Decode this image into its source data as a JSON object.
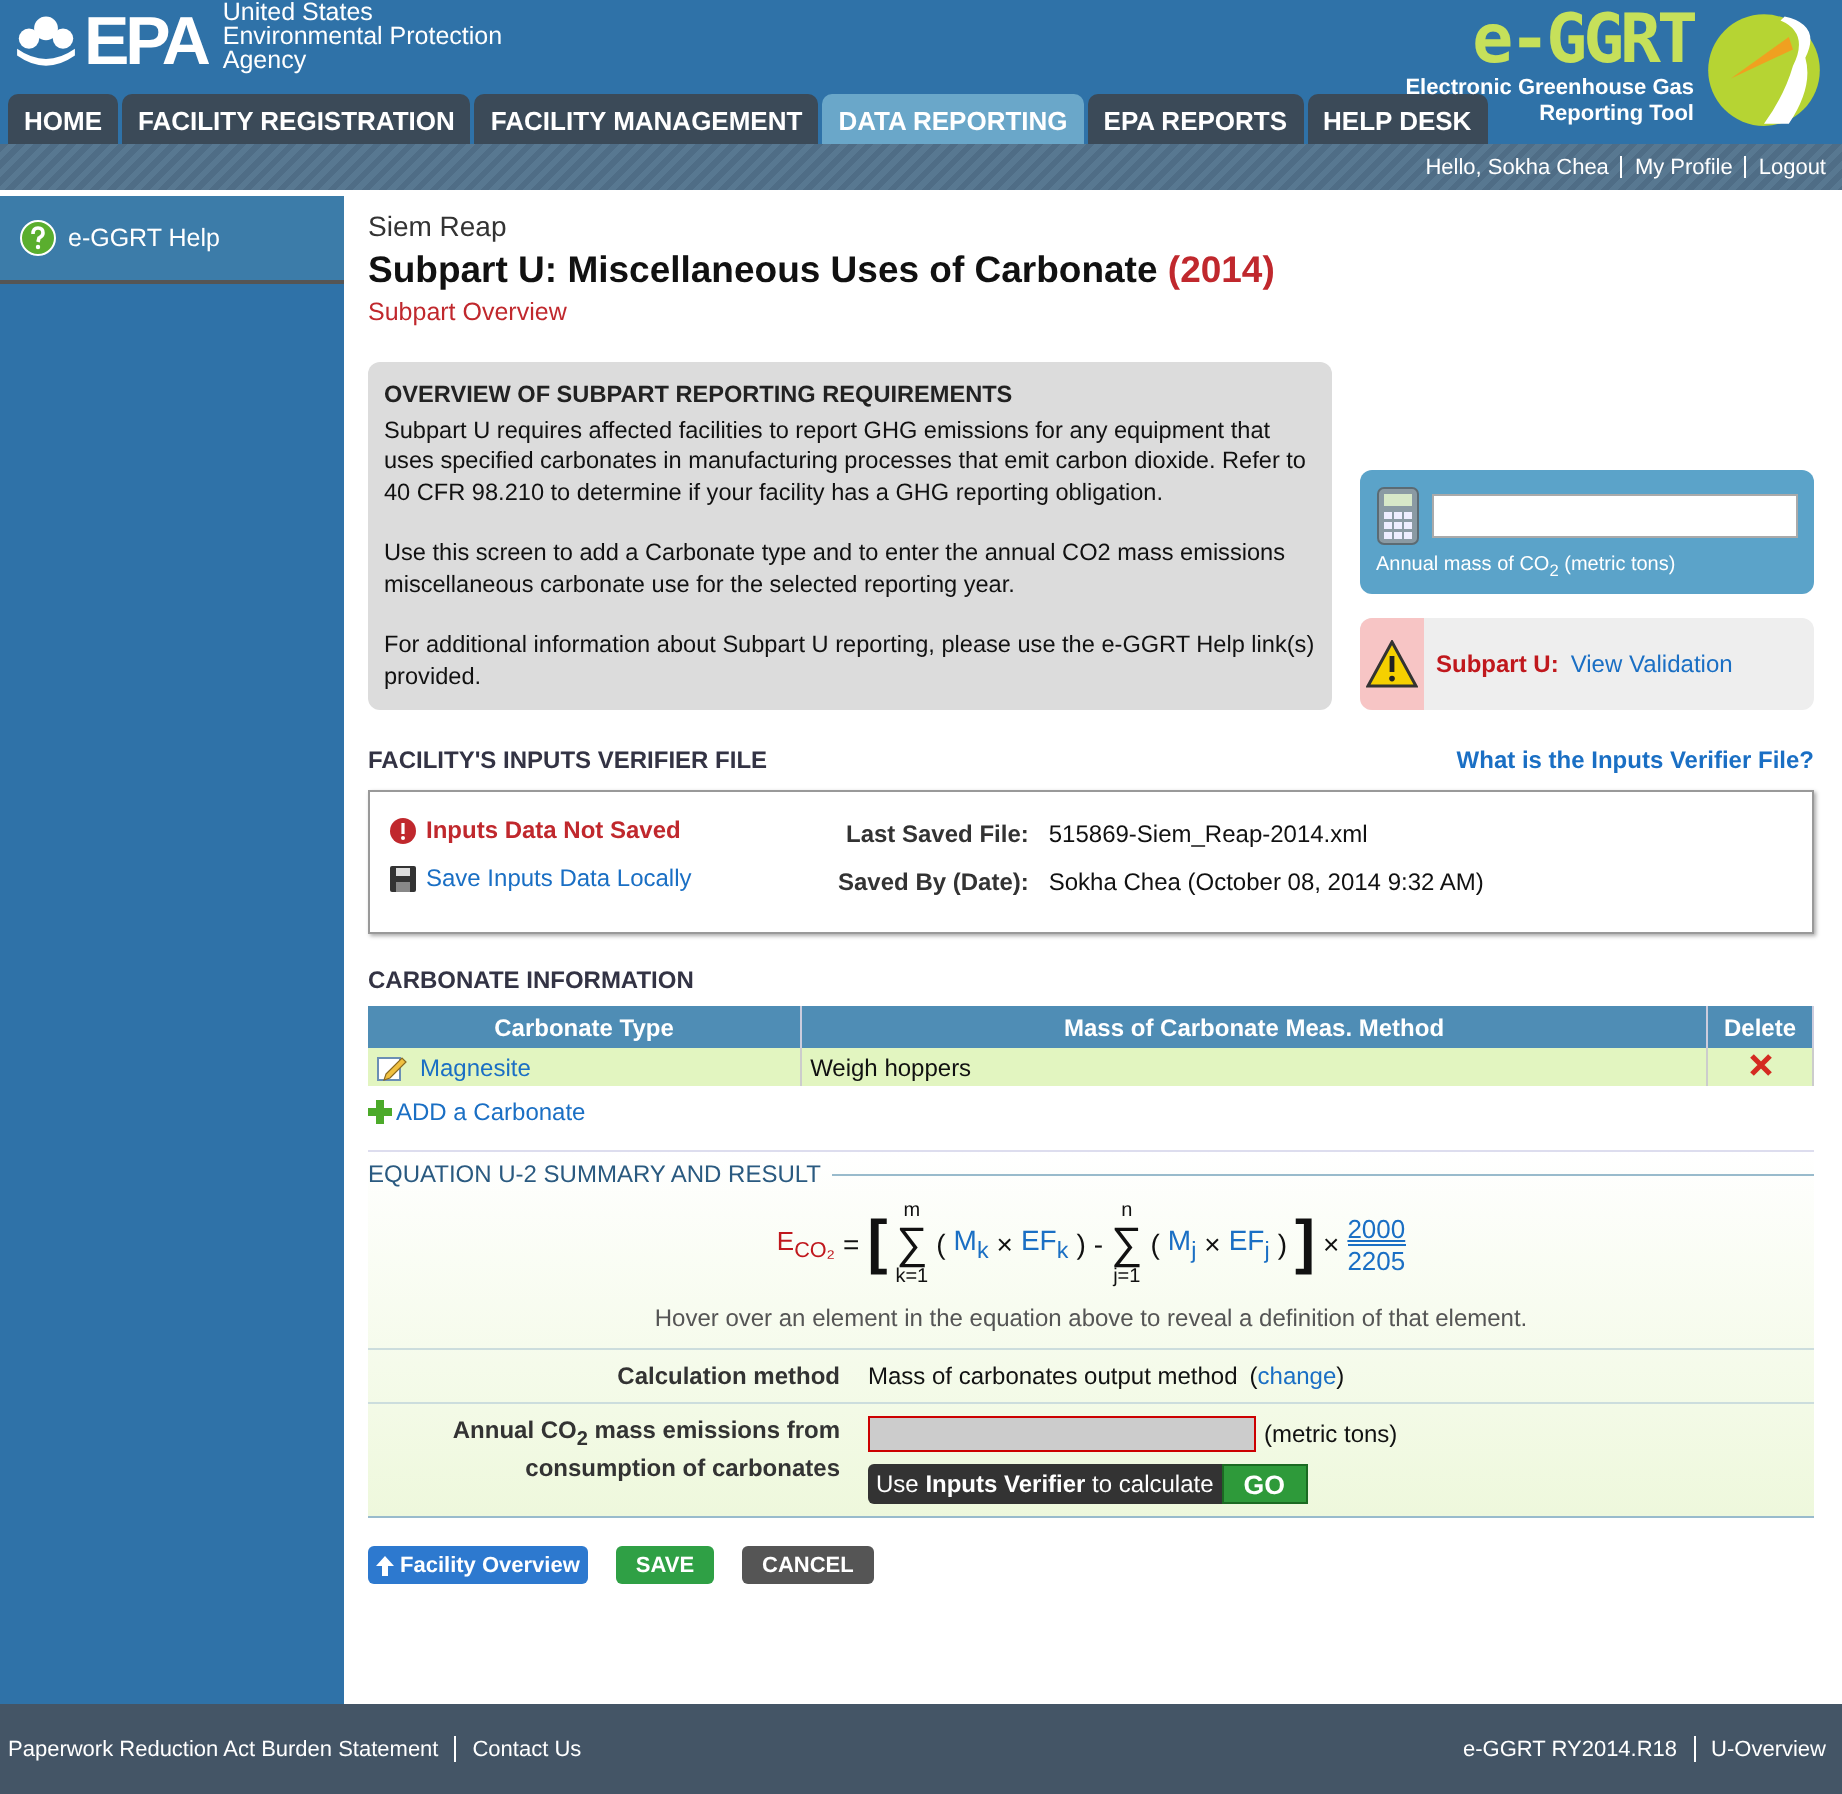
{
  "header": {
    "agency_mark": "EPA",
    "agency_name": [
      "United States",
      "Environmental Protection",
      "Agency"
    ],
    "app_logo": "e-GGRT",
    "app_name": [
      "Electronic Greenhouse Gas",
      "Reporting Tool"
    ]
  },
  "tabs": [
    {
      "label": "HOME",
      "selected": false
    },
    {
      "label": "FACILITY REGISTRATION",
      "selected": false
    },
    {
      "label": "FACILITY MANAGEMENT",
      "selected": false
    },
    {
      "label": "DATA REPORTING",
      "selected": true
    },
    {
      "label": "EPA REPORTS",
      "selected": false
    },
    {
      "label": "HELP DESK",
      "selected": false
    }
  ],
  "user_links": [
    "Hello, Sokha Chea",
    "My Profile",
    "Logout"
  ],
  "sidebar": {
    "items": [
      {
        "label": "e-GGRT Help",
        "selected": true
      }
    ]
  },
  "facility": "Siem Reap",
  "title": "Subpart U: Miscellaneous Uses of Carbonate",
  "year": "(2014)",
  "subtitle": "Subpart Overview",
  "overview": {
    "heading": "OVERVIEW OF SUBPART REPORTING REQUIREMENTS",
    "paragraphs": [
      "Subpart U requires affected facilities to report GHG emissions for any equipment that uses specified carbonates in manufacturing processes that emit carbon dioxide. Refer to 40 CFR 98.210 to determine if your facility has a GHG reporting obligation.",
      "Use this screen to add a Carbonate type and to enter the annual CO2 mass emissions miscellaneous carbonate use for the selected reporting year.",
      "For additional information about Subpart U reporting, please use the e-GGRT Help link(s) provided."
    ]
  },
  "annual_mass": {
    "label": "Annual mass of CO$_{2}$ (metric tons)"
  },
  "validation": {
    "label": "Subpart U:",
    "link": "View Validation"
  },
  "verifier": {
    "heading": "FACILITY'S INPUTS VERIFIER FILE",
    "help_link": "What is the Inputs Verifier File?",
    "status": "Inputs Data Not Saved",
    "save_link": "Save Inputs Data Locally",
    "fields": [
      {
        "label": "Last Saved File:",
        "value": "515869-Siem_Reap-2014.xml"
      },
      {
        "label": "Saved By (Date):",
        "value": "Sokha Chea (October 08, 2014 9:32 AM)"
      }
    ]
  },
  "carbonates": {
    "heading": "CARBONATE INFORMATION",
    "columns": [
      "Carbonate Type",
      "Mass of Carbonate Meas. Method",
      "Delete"
    ],
    "rows": [
      {
        "type": "Magnesite",
        "method": "Weigh hoppers"
      }
    ],
    "add_link": "ADD a Carbonate"
  },
  "equation": {
    "heading": "EQUATION U-2 SUMMARY AND RESULT",
    "tokens": [
      {
        "kind": "result",
        "text": "E$_{CO₂}$"
      },
      {
        "kind": "op",
        "text": "="
      },
      {
        "kind": "bracket",
        "text": "["
      },
      {
        "kind": "sum",
        "symbol": "∑",
        "upper": "m",
        "lower": "k=1"
      },
      {
        "kind": "op",
        "text": "("
      },
      {
        "kind": "var",
        "text": "M$_{k}$"
      },
      {
        "kind": "op",
        "text": "×"
      },
      {
        "kind": "var",
        "text": "EF$_{k}$"
      },
      {
        "kind": "op",
        "text": ")"
      },
      {
        "kind": "op",
        "text": "-"
      },
      {
        "kind": "sum",
        "symbol": "∑",
        "upper": "n",
        "lower": "j=1"
      },
      {
        "kind": "op",
        "text": "("
      },
      {
        "kind": "var",
        "text": "M$_{j}$"
      },
      {
        "kind": "op",
        "text": "×"
      },
      {
        "kind": "var",
        "text": "EF$_{j}$"
      },
      {
        "kind": "op",
        "text": ")"
      },
      {
        "kind": "bracket",
        "text": "]"
      },
      {
        "kind": "op",
        "text": "×"
      },
      {
        "kind": "frac",
        "num": "2000",
        "den": "2205"
      }
    ],
    "hint": "Hover over an element in the equation above to reveal a definition of that element.",
    "calc_label": "Calculation method",
    "calc_value": "Mass of carbonates output method",
    "change_open": "(",
    "change_link": "change",
    "change_close": ")",
    "annual_label": "Annual CO$_{2}$ mass emissions from consumption of carbonates",
    "annual_unit": "(metric tons)",
    "tooltip": "Use **Inputs Verifier** to calculate",
    "go": "GO"
  },
  "buttons": {
    "overview": "Facility Overview",
    "save": "SAVE",
    "cancel": "CANCEL"
  },
  "footer": {
    "left": [
      "Paperwork Reduction Act Burden Statement",
      "Contact Us"
    ],
    "right": [
      "e-GGRT RY2014.R18",
      "U-Overview"
    ]
  }
}
